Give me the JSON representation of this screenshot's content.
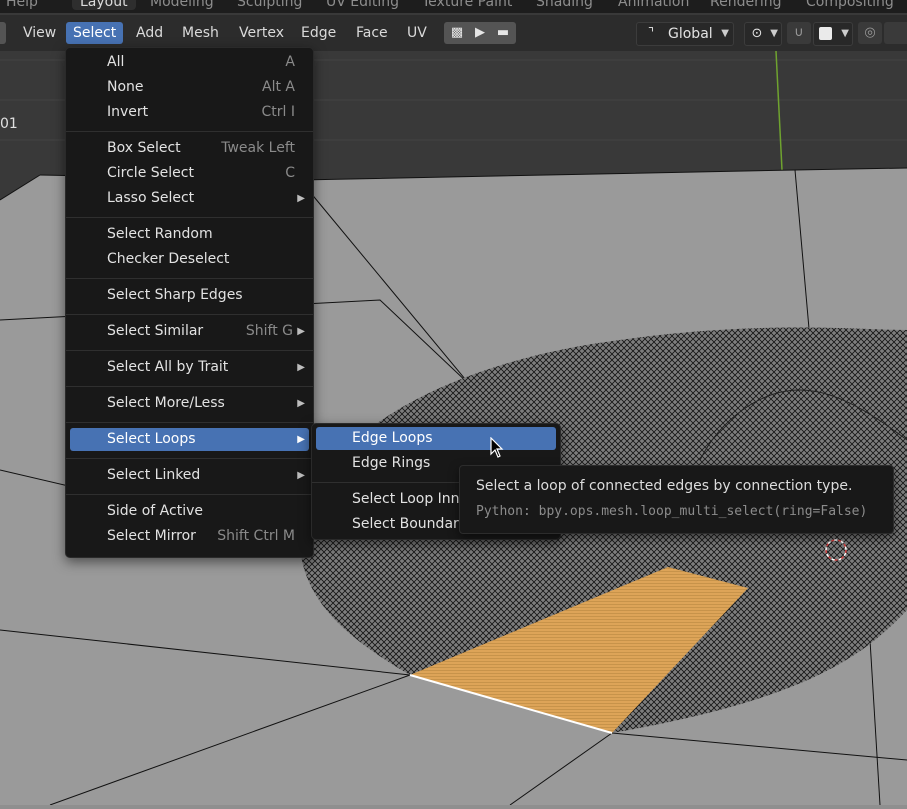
{
  "top_bar": {
    "tabs": [
      "Help",
      "Layout",
      "Modeling",
      "Sculpting",
      "UV Editing",
      "Texture Paint",
      "Shading",
      "Animation",
      "Rendering",
      "Compositing"
    ],
    "active_tab": "Layout"
  },
  "header": {
    "menus": [
      "View",
      "Select",
      "Add",
      "Mesh",
      "Vertex",
      "Edge",
      "Face",
      "UV"
    ],
    "active_menu": "Select",
    "transform_orientation": "Global",
    "icons": [
      "film-icon",
      "play-icon",
      "folder-icon",
      "transform-axes-icon",
      "pivot-icon",
      "snap-magnet-icon",
      "snap-target-icon",
      "proportional-edit-icon"
    ]
  },
  "viewport": {
    "overlay_text": "01",
    "colors": {
      "mesh_face": "#9a9a9a",
      "selected_face": "#e0a855",
      "wire": "#111111",
      "background": "#3a3a3a",
      "grid_green": "#6fa32f"
    }
  },
  "select_menu": {
    "items": [
      {
        "label": "All",
        "shortcut": "A"
      },
      {
        "label": "None",
        "shortcut": "Alt A"
      },
      {
        "label": "Invert",
        "shortcut": "Ctrl I"
      },
      {
        "label": "Box Select",
        "shortcut": "Tweak Left"
      },
      {
        "label": "Circle Select",
        "shortcut": "C"
      },
      {
        "label": "Lasso Select",
        "shortcut": ""
      },
      {
        "label": "Select Random",
        "shortcut": ""
      },
      {
        "label": "Checker Deselect",
        "shortcut": ""
      },
      {
        "label": "Select Sharp Edges",
        "shortcut": ""
      },
      {
        "label": "Select Similar",
        "shortcut": "Shift G"
      },
      {
        "label": "Select All by Trait",
        "shortcut": ""
      },
      {
        "label": "Select More/Less",
        "shortcut": ""
      },
      {
        "label": "Select Loops",
        "shortcut": ""
      },
      {
        "label": "Select Linked",
        "shortcut": ""
      },
      {
        "label": "Side of Active",
        "shortcut": ""
      },
      {
        "label": "Select Mirror",
        "shortcut": "Shift Ctrl M"
      }
    ],
    "highlighted": "Select Loops"
  },
  "loops_submenu": {
    "items": [
      "Edge Loops",
      "Edge Rings",
      "Select Loop Inn",
      "Select Boundar"
    ],
    "highlighted": "Edge Loops"
  },
  "tooltip": {
    "description": "Select a loop of connected edges by connection type.",
    "python": "Python: bpy.ops.mesh.loop_multi_select(ring=False)"
  }
}
